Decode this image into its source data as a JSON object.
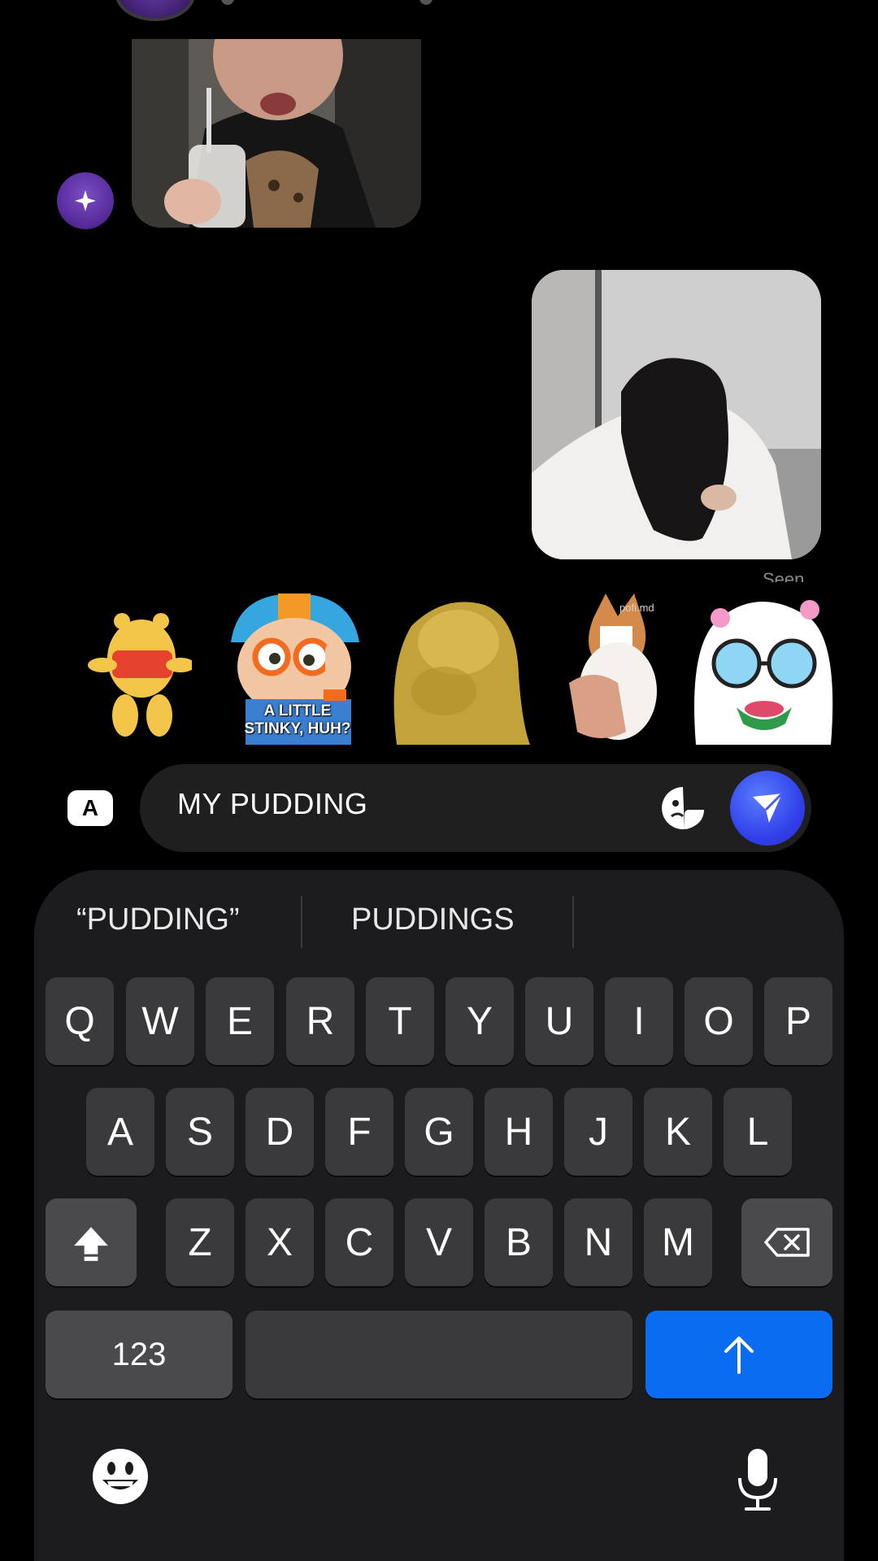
{
  "conversation": {
    "seen_label": "Seen"
  },
  "stickers": {
    "blippi_caption": "A LITTLE STINKY, HUH?",
    "corgi_watermark": "pofi.md"
  },
  "composer": {
    "keyboard_switch_label": "A",
    "text": "MY PUDDING"
  },
  "keyboard": {
    "suggestions": [
      "“PUDDING”",
      "PUDDINGS"
    ],
    "row1": [
      "Q",
      "W",
      "E",
      "R",
      "T",
      "Y",
      "U",
      "I",
      "O",
      "P"
    ],
    "row2": [
      "A",
      "S",
      "D",
      "F",
      "G",
      "H",
      "J",
      "K",
      "L"
    ],
    "row3": [
      "Z",
      "X",
      "C",
      "V",
      "B",
      "N",
      "M"
    ],
    "numbers_label": "123"
  },
  "colors": {
    "background": "#000000",
    "accent_blue": "#0a6cf0",
    "send_gradient": "#2f3ee8",
    "avatar_purple": "#5a2e9e",
    "keyboard_bg": "#1c1c1e",
    "key_bg": "#3a3a3c"
  },
  "icons": {
    "avatar": "sparkle-icon",
    "sticker_button": "sticker-face-icon",
    "send": "paper-plane-icon",
    "shift": "shift-arrow-icon",
    "delete": "backspace-icon",
    "return": "up-arrow-icon",
    "emoji": "emoji-face-icon",
    "mic": "microphone-icon"
  }
}
